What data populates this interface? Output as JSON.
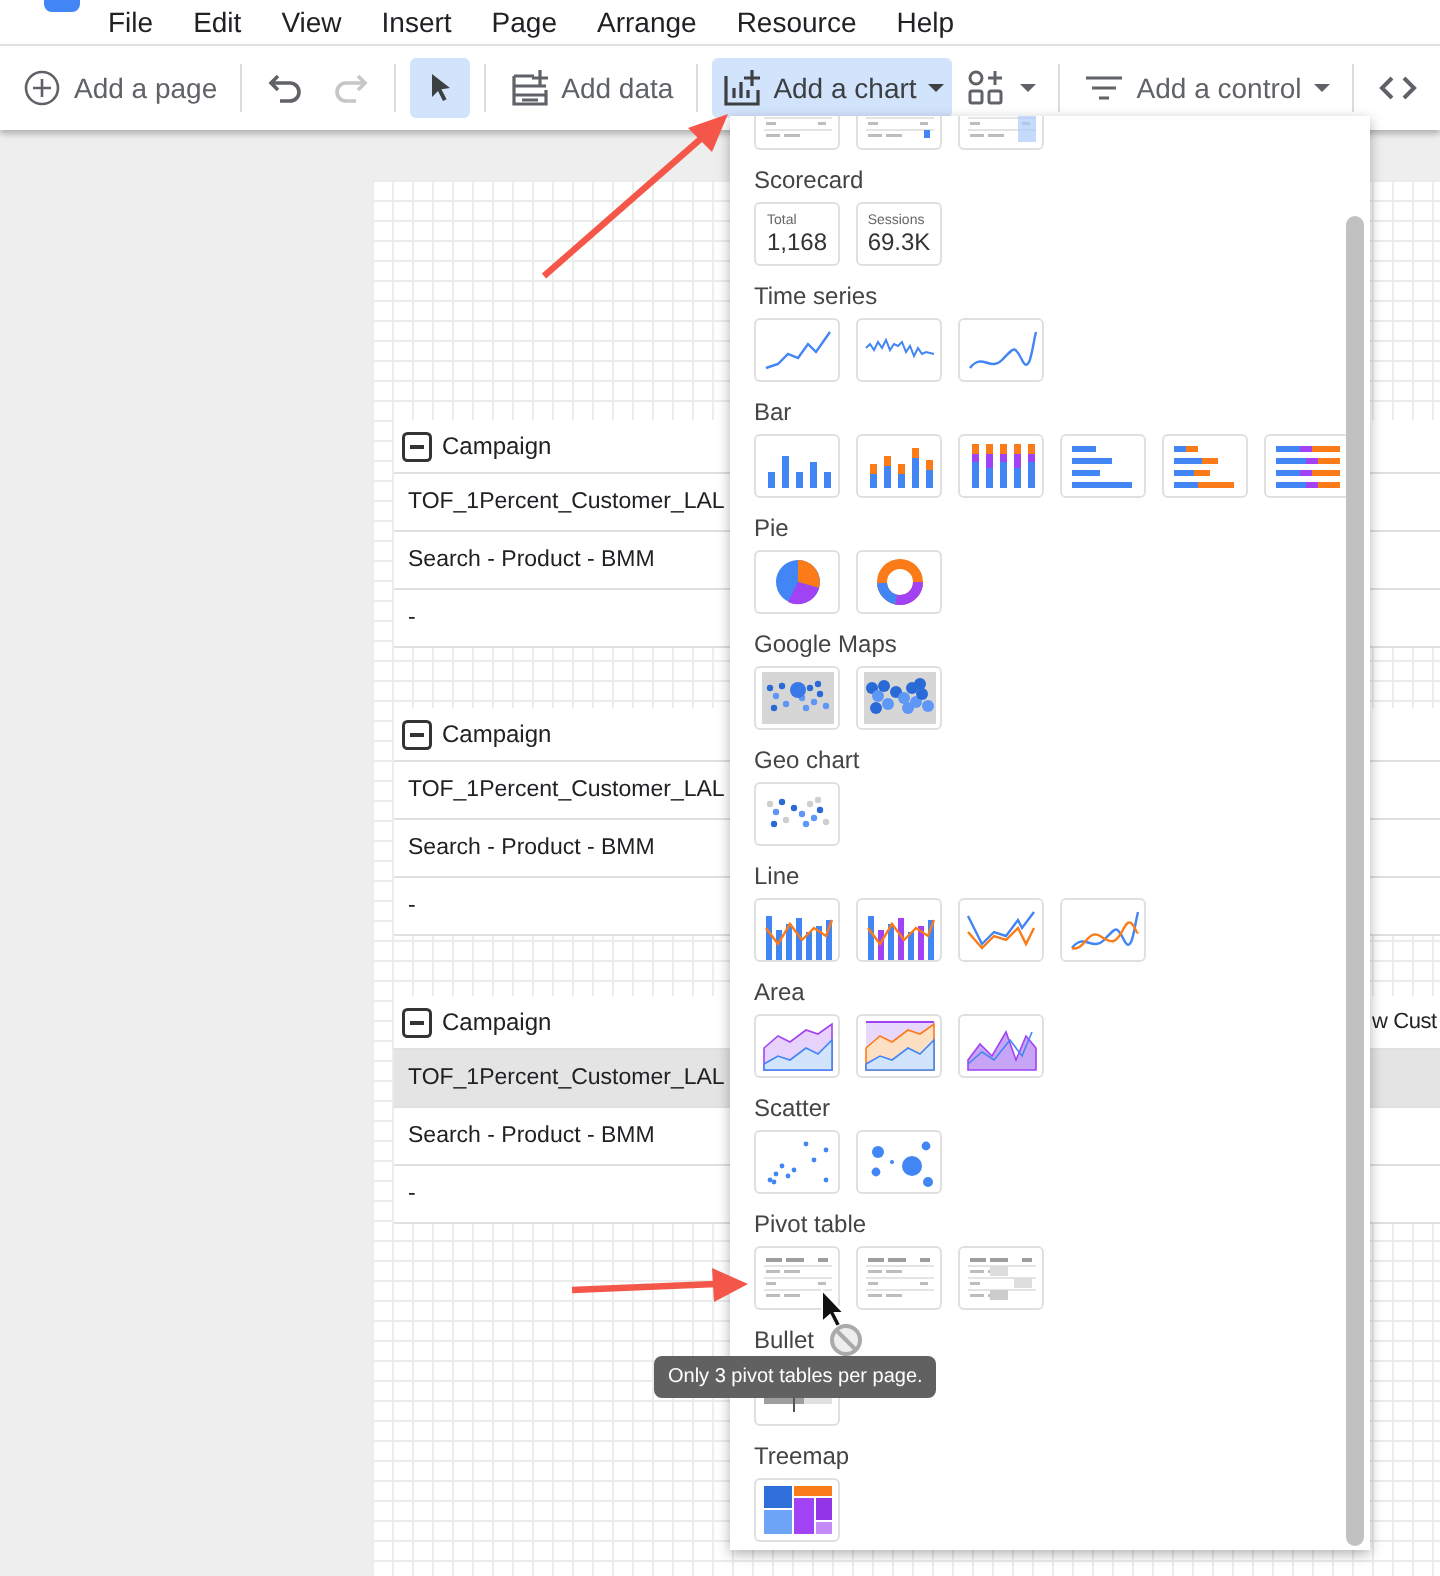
{
  "menu": [
    {
      "label": "File"
    },
    {
      "label": "Edit"
    },
    {
      "label": "View"
    },
    {
      "label": "Insert"
    },
    {
      "label": "Page"
    },
    {
      "label": "Arrange"
    },
    {
      "label": "Resource"
    },
    {
      "label": "Help"
    }
  ],
  "toolbar": {
    "groups": [
      [
        {
          "kind": "add-page",
          "label": "Add a page",
          "selected": false,
          "disabled": false
        }
      ],
      [
        {
          "kind": "undo",
          "selected": false,
          "disabled": false
        },
        {
          "kind": "redo",
          "selected": false,
          "disabled": true
        }
      ],
      [
        {
          "kind": "select",
          "selected": true,
          "disabled": false
        }
      ],
      [
        {
          "kind": "add-data",
          "label": "Add data",
          "selected": false,
          "disabled": false
        }
      ],
      [
        {
          "kind": "add-chart",
          "label": "Add a chart",
          "selected": true,
          "disabled": false,
          "has_menu": true
        },
        {
          "kind": "add-component",
          "selected": false,
          "disabled": false,
          "has_menu": true
        }
      ],
      [
        {
          "kind": "add-control",
          "label": "Add a control",
          "selected": false,
          "disabled": false,
          "has_menu": true
        }
      ],
      [
        {
          "kind": "embed",
          "selected": false,
          "disabled": false
        }
      ]
    ]
  },
  "canvas": {
    "tables": [
      {
        "header": "Campaign",
        "rows": [
          {
            "text": "TOF_1Percent_Customer_LAL",
            "selected": false
          },
          {
            "text": "Search - Product - BMM",
            "selected": false
          },
          {
            "text": "-",
            "selected": false
          }
        ]
      },
      {
        "header": "Campaign",
        "rows": [
          {
            "text": "TOF_1Percent_Customer_LAL",
            "selected": false
          },
          {
            "text": "Search - Product - BMM",
            "selected": false
          },
          {
            "text": "-",
            "selected": false
          }
        ]
      },
      {
        "header": "Campaign",
        "column_2_header": "w Cust",
        "rows": [
          {
            "text": "TOF_1Percent_Customer_LAL",
            "selected": true
          },
          {
            "text": "Search - Product - BMM",
            "selected": false
          },
          {
            "text": "-",
            "selected": false
          }
        ]
      }
    ]
  },
  "chart_menu": {
    "sections": [
      {
        "items": [
          {
            "kind": "table"
          },
          {
            "kind": "table-bars"
          },
          {
            "kind": "table-heatmap"
          }
        ]
      },
      {
        "title": "Scorecard",
        "items": [
          {
            "kind": "scorecard",
            "label": "Total",
            "value": "1,168"
          },
          {
            "kind": "scorecard",
            "label": "Sessions",
            "value": "69.3K"
          }
        ]
      },
      {
        "title": "Time series",
        "items": [
          {
            "kind": "time-series"
          },
          {
            "kind": "time-series-sparkline"
          },
          {
            "kind": "time-series-smooth"
          }
        ]
      },
      {
        "title": "Bar",
        "items": [
          {
            "kind": "column"
          },
          {
            "kind": "column-stacked"
          },
          {
            "kind": "column-100"
          },
          {
            "kind": "bar"
          },
          {
            "kind": "bar-stacked"
          },
          {
            "kind": "bar-100"
          }
        ]
      },
      {
        "title": "Pie",
        "items": [
          {
            "kind": "pie"
          },
          {
            "kind": "donut"
          }
        ]
      },
      {
        "title": "Google Maps",
        "items": [
          {
            "kind": "bubble-map"
          },
          {
            "kind": "filled-map"
          }
        ]
      },
      {
        "title": "Geo chart",
        "items": [
          {
            "kind": "geo-map"
          }
        ]
      },
      {
        "title": "Line",
        "items": [
          {
            "kind": "combo"
          },
          {
            "kind": "combo-stacked"
          },
          {
            "kind": "line"
          },
          {
            "kind": "line-smooth"
          }
        ]
      },
      {
        "title": "Area",
        "items": [
          {
            "kind": "area"
          },
          {
            "kind": "area-stacked"
          },
          {
            "kind": "area-100"
          }
        ]
      },
      {
        "title": "Scatter",
        "items": [
          {
            "kind": "scatter"
          },
          {
            "kind": "bubble"
          }
        ]
      },
      {
        "title": "Pivot table",
        "items": [
          {
            "kind": "pivot"
          },
          {
            "kind": "pivot-bars"
          },
          {
            "kind": "pivot-heatmap"
          }
        ]
      },
      {
        "title": "Bullet",
        "items": [
          {
            "kind": "bullet"
          }
        ]
      },
      {
        "title": "Treemap",
        "items": [
          {
            "kind": "treemap"
          }
        ]
      }
    ]
  },
  "tooltip": {
    "text": "Only 3 pivot tables per page."
  }
}
